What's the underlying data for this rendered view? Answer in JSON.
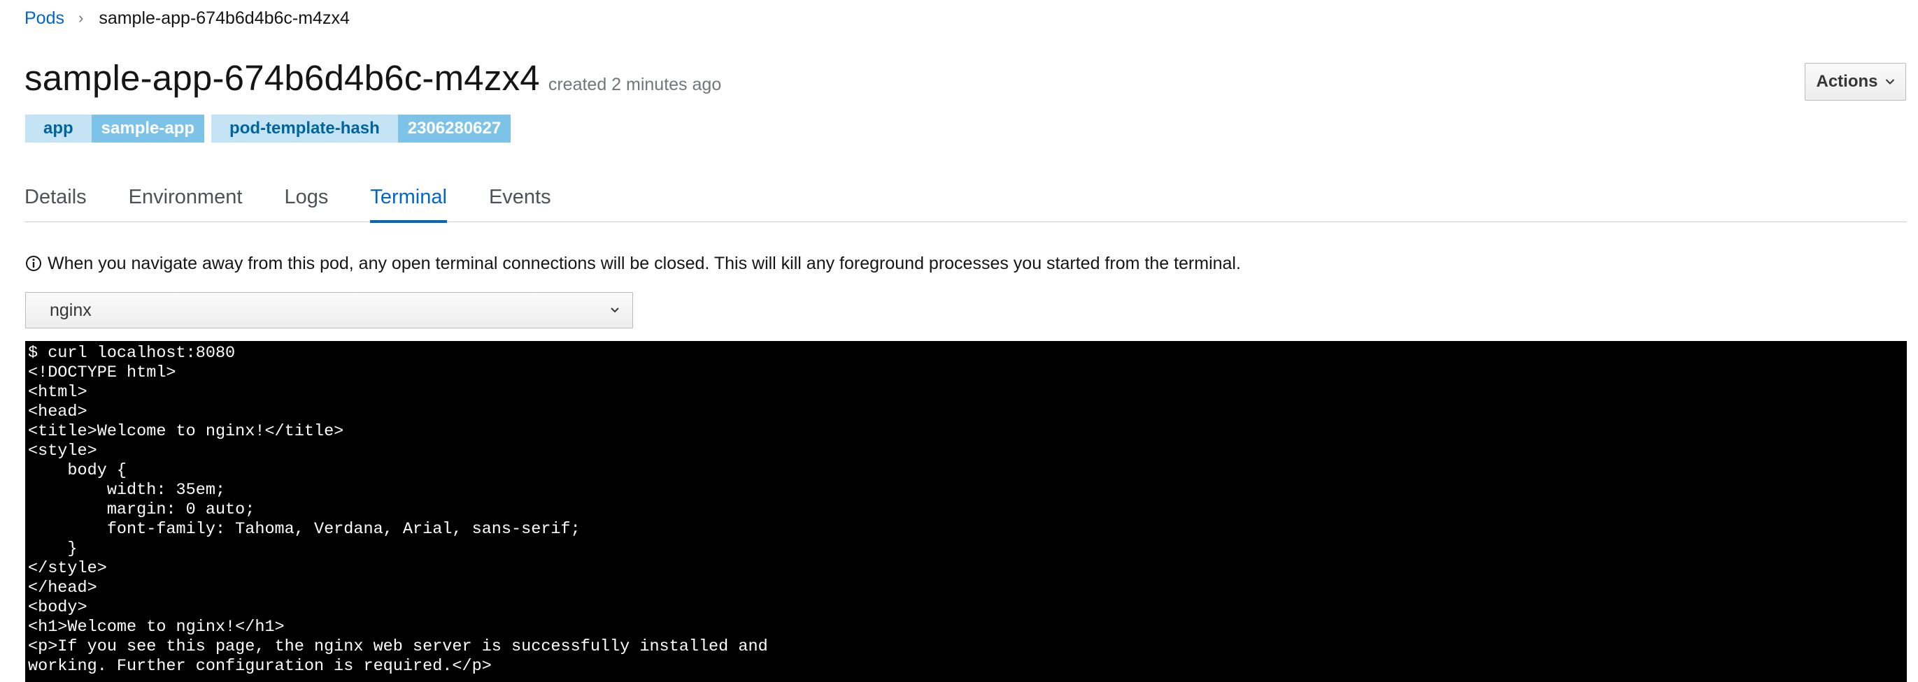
{
  "breadcrumb": {
    "parent": "Pods",
    "separator": "›",
    "current": "sample-app-674b6d4b6c-m4zx4"
  },
  "header": {
    "title": "sample-app-674b6d4b6c-m4zx4",
    "created": "created 2 minutes ago",
    "actions_label": "Actions"
  },
  "labels": [
    {
      "key": "app",
      "value": "sample-app"
    },
    {
      "key": "pod-template-hash",
      "value": "2306280627"
    }
  ],
  "tabs": [
    {
      "label": "Details",
      "active": false
    },
    {
      "label": "Environment",
      "active": false
    },
    {
      "label": "Logs",
      "active": false
    },
    {
      "label": "Terminal",
      "active": true
    },
    {
      "label": "Events",
      "active": false
    }
  ],
  "info": {
    "icon": "info-circle-icon",
    "text": "When you navigate away from this pod, any open terminal connections will be closed. This will kill any foreground processes you started from the terminal."
  },
  "container_select": {
    "selected": "nginx"
  },
  "terminal": {
    "lines": [
      "$ curl localhost:8080",
      "<!DOCTYPE html>",
      "<html>",
      "<head>",
      "<title>Welcome to nginx!</title>",
      "<style>",
      "    body {",
      "        width: 35em;",
      "        margin: 0 auto;",
      "        font-family: Tahoma, Verdana, Arial, sans-serif;",
      "    }",
      "</style>",
      "</head>",
      "<body>",
      "<h1>Welcome to nginx!</h1>",
      "<p>If you see this page, the nginx web server is successfully installed and",
      "working. Further configuration is required.</p>"
    ]
  },
  "colors": {
    "link": "#0066cc",
    "label_key_bg": "#c4e4f6",
    "label_val_bg": "#7dc3e8",
    "terminal_bg": "#000000"
  }
}
